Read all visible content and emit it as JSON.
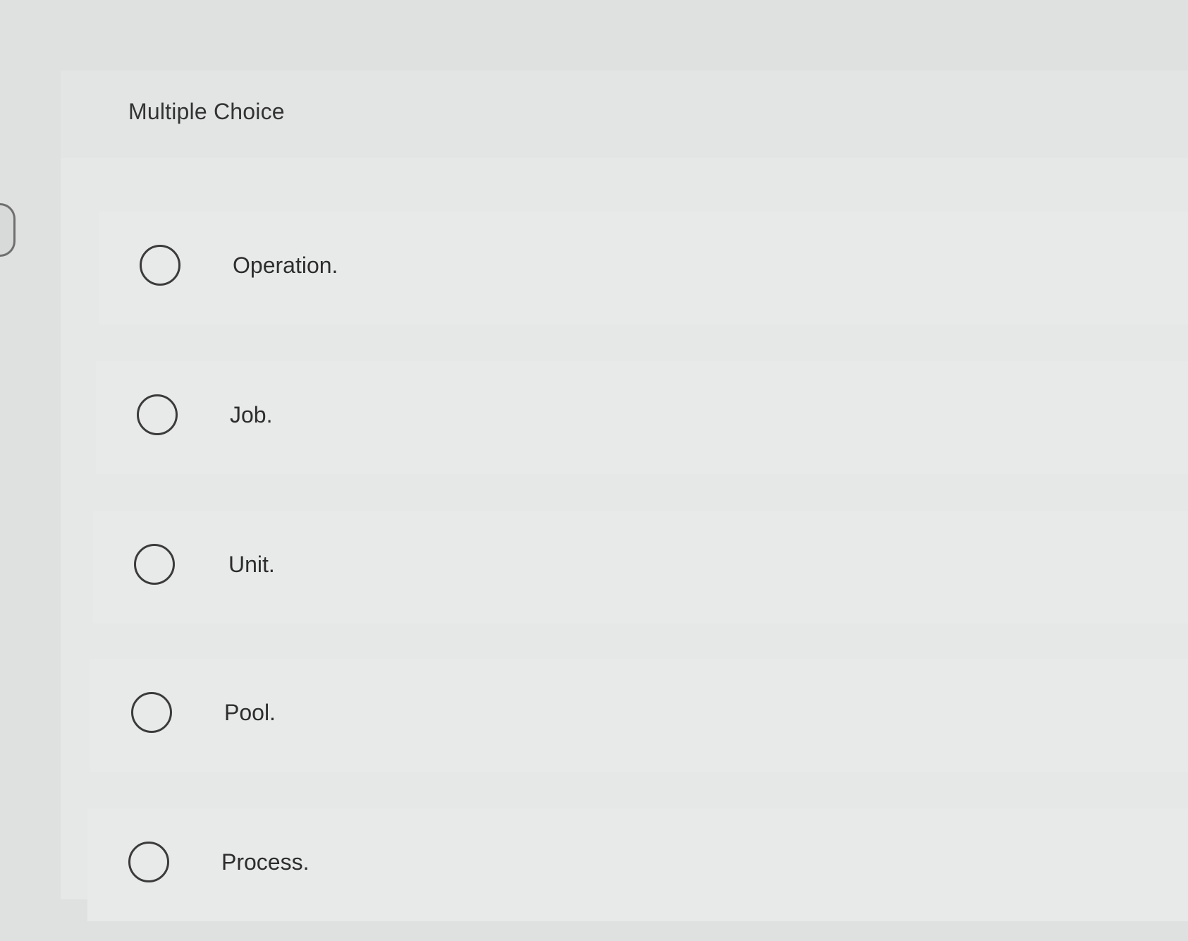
{
  "question": {
    "type_label": "Multiple Choice"
  },
  "choices": [
    {
      "label": "Operation."
    },
    {
      "label": "Job."
    },
    {
      "label": "Unit."
    },
    {
      "label": "Pool."
    },
    {
      "label": "Process."
    }
  ],
  "icons": {
    "side_control": "partial-circle-control-icon",
    "choice_control": "radio-button-icon"
  }
}
